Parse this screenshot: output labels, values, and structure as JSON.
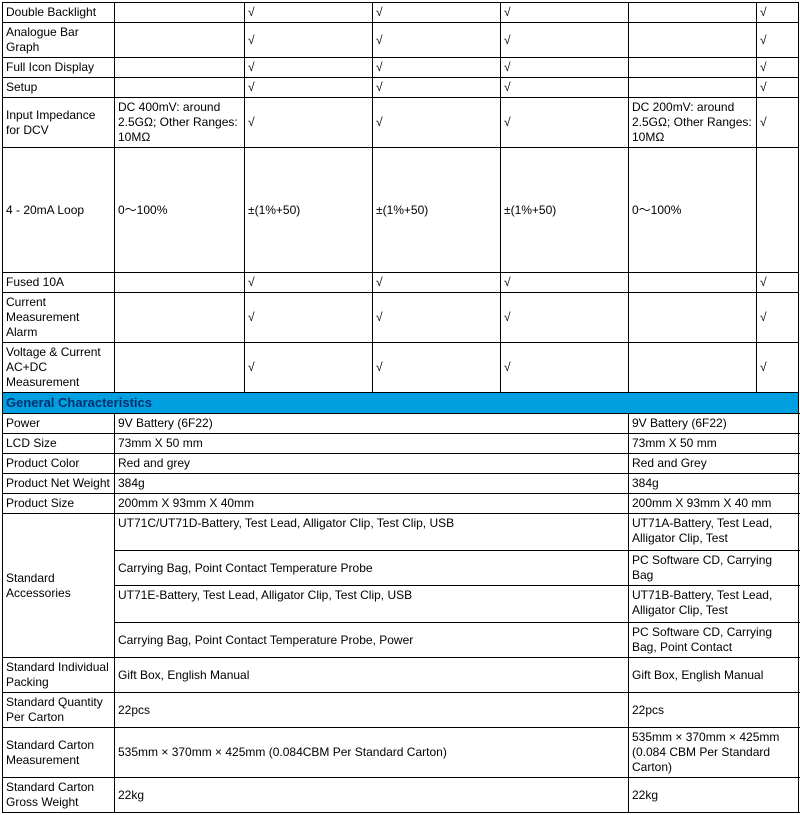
{
  "check": "√",
  "rows": {
    "doubleBacklight": "Double Backlight",
    "analogueBar": "Analogue Bar Graph",
    "fullIcon": "Full Icon Display",
    "setup": "Setup",
    "inputImpedance": "Input Impedance for DCV",
    "dc400": "DC 400mV: around 2.5GΩ; Other Ranges: 10MΩ",
    "dc200": "DC 200mV: around 2.5GΩ; Other Ranges: 10MΩ",
    "loop": "4 - 20mA Loop",
    "loopVal": "0～100%",
    "loopTol": "±(1%+50)",
    "fused10a": "Fused 10A",
    "currentAlarm": "Current Measurement Alarm",
    "vcMeas": "Voltage & Current AC+DC Measurement",
    "generalHeader": "General Characteristics",
    "power": "Power",
    "powerVal": "9V Battery (6F22)",
    "lcd": "LCD Size",
    "lcdVal": "73mm X 50 mm",
    "color": "Product Color",
    "colorVal1": "Red and grey",
    "colorVal2": "Red and Grey",
    "weight": "Product Net Weight",
    "weightVal": "384g",
    "size": "Product Size",
    "sizeVal1": "200mm X 93mm X 40mm",
    "sizeVal2": "200mm X 93mm X 40 mm",
    "accessories": "Standard Accessories",
    "acc1a": "UT71C/UT71D-Battery, Test Lead, Alligator Clip, Test Clip, USB",
    "acc1b": "UT71A-Battery, Test Lead, Alligator Clip, Test",
    "acc2a": " Carrying Bag, Point Contact Temperature Probe",
    "acc2b": " PC Software CD, Carrying Bag",
    "acc3a": "UT71E-Battery, Test Lead, Alligator Clip, Test Clip, USB",
    "acc3b": "UT71B-Battery, Test Lead, Alligator Clip, Test",
    "acc4a": "Carrying Bag, Point Contact Temperature Probe, Power",
    "acc4b": "PC Software CD, Carrying Bag, Point Contact",
    "packing": "Standard Individual Packing",
    "packingVal": "Gift Box, English Manual",
    "qty": "Standard Quantity Per Carton",
    "qtyVal": "22pcs",
    "carton": "Standard Carton Measurement",
    "cartonVal1": "535mm × 370mm × 425mm (0.084CBM Per Standard Carton)",
    "cartonVal2": "535mm × 370mm × 425mm (0.084 CBM Per Standard Carton)",
    "gross": "Standard Carton Gross Weight",
    "grossVal": "22kg"
  }
}
